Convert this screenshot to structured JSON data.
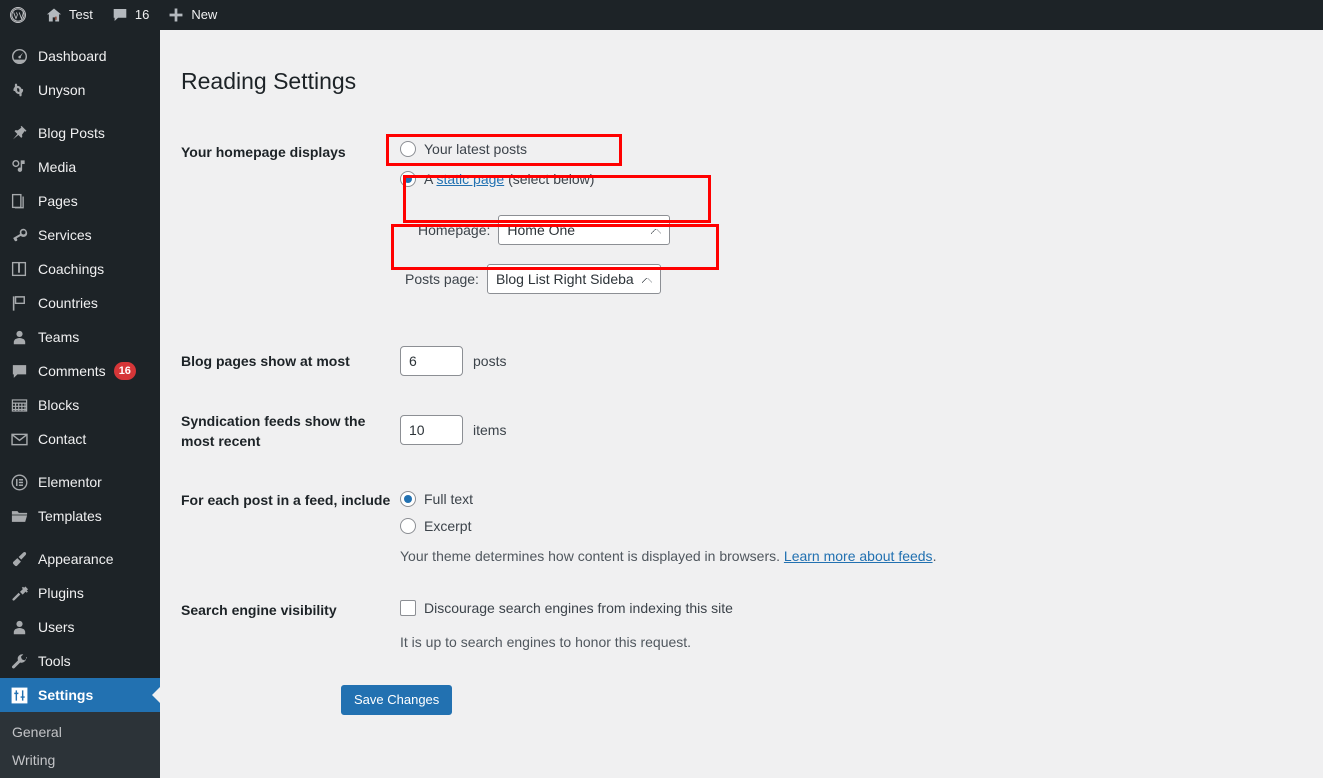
{
  "adminbar": {
    "items": [
      {
        "icon": "wordpress-logo-icon",
        "label": ""
      },
      {
        "icon": "home-icon",
        "label": "Test"
      },
      {
        "icon": "comment-bubble-icon",
        "label": "16"
      },
      {
        "icon": "plus-icon",
        "label": "New"
      }
    ]
  },
  "sidebar": {
    "items": [
      {
        "label": "Dashboard",
        "icon": "dashboard-icon",
        "current": false
      },
      {
        "label": "Unyson",
        "icon": "unyson-icon",
        "current": false
      },
      {
        "label": "Blog Posts",
        "icon": "pin-icon",
        "current": false
      },
      {
        "label": "Media",
        "icon": "media-icon",
        "current": false
      },
      {
        "label": "Pages",
        "icon": "pages-icon",
        "current": false
      },
      {
        "label": "Services",
        "icon": "megaphone-icon",
        "current": false
      },
      {
        "label": "Coachings",
        "icon": "book-icon",
        "current": false
      },
      {
        "label": "Countries",
        "icon": "flag-icon",
        "current": false
      },
      {
        "label": "Teams",
        "icon": "user-icon",
        "current": false
      },
      {
        "label": "Comments",
        "icon": "comment-icon",
        "current": false,
        "badge": "16"
      },
      {
        "label": "Blocks",
        "icon": "blocks-icon",
        "current": false
      },
      {
        "label": "Contact",
        "icon": "envelope-icon",
        "current": false
      },
      {
        "label": "Elementor",
        "icon": "elementor-icon",
        "current": false
      },
      {
        "label": "Templates",
        "icon": "folder-icon",
        "current": false
      },
      {
        "label": "Appearance",
        "icon": "paintbrush-icon",
        "current": false
      },
      {
        "label": "Plugins",
        "icon": "plug-icon",
        "current": false
      },
      {
        "label": "Users",
        "icon": "users-icon",
        "current": false
      },
      {
        "label": "Tools",
        "icon": "wrench-icon",
        "current": false
      },
      {
        "label": "Settings",
        "icon": "settings-sliders-icon",
        "current": true
      }
    ],
    "submenu": [
      {
        "label": "General"
      },
      {
        "label": "Writing"
      }
    ]
  },
  "page": {
    "title": "Reading Settings"
  },
  "homepage_displays": {
    "label": "Your homepage displays",
    "option_latest_posts": "Your latest posts",
    "option_static_prefix": "A ",
    "option_static_link": "static page",
    "option_static_suffix": " (select below)",
    "selected": "static_page",
    "homepage_label": "Homepage:",
    "homepage_value": "Home One",
    "posts_page_label": "Posts page:",
    "posts_page_value": "Blog List Right Sidebar"
  },
  "blog_pages": {
    "label": "Blog pages show at most",
    "value": "6",
    "unit": "posts"
  },
  "syndication": {
    "label": "Syndication feeds show the most recent",
    "value": "10",
    "unit": "items"
  },
  "feed_include": {
    "label": "For each post in a feed, include",
    "option_full_text": "Full text",
    "option_excerpt": "Excerpt",
    "selected": "full_text",
    "description_prefix": "Your theme determines how content is displayed in browsers. ",
    "description_link": "Learn more about feeds",
    "description_suffix": "."
  },
  "search_visibility": {
    "label": "Search engine visibility",
    "checkbox_label": "Discourage search engines from indexing this site",
    "checked": false,
    "note": "It is up to search engines to honor this request."
  },
  "actions": {
    "save_label": "Save Changes"
  },
  "colors": {
    "accent": "#2271b1",
    "sidebar_bg": "#1d2327",
    "submenu_bg": "#2c3338",
    "badge": "#d63638",
    "annotation": "#ff0000",
    "content_bg": "#f0f0f1"
  }
}
